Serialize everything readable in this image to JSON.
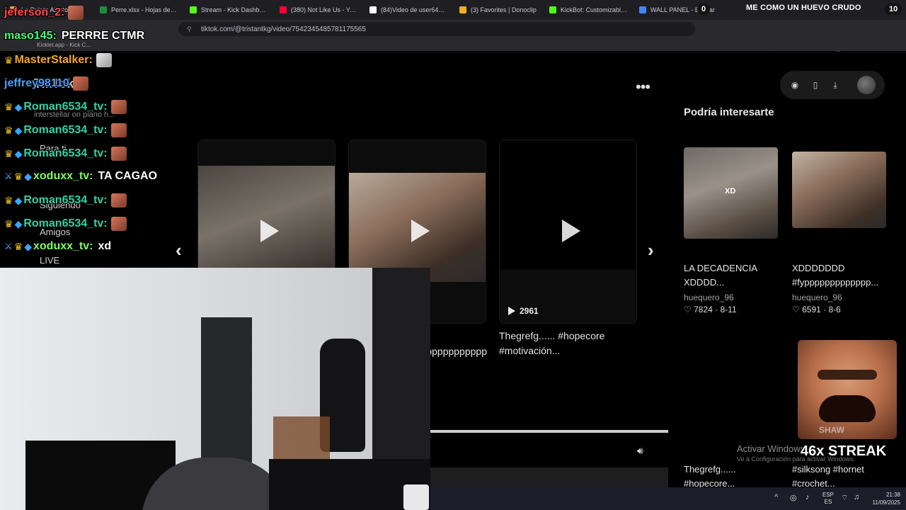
{
  "browser": {
    "tabs": [
      {
        "label": "La Ruleta Aleato...",
        "color": "#e5a93d"
      },
      {
        "label": "Perre.xlsx - Hojas de cálculo",
        "color": "#1e8e3e"
      },
      {
        "label": "Stream - Kick Dashboard",
        "color": "#53fc18"
      },
      {
        "label": "(380) Not Like Us - YouTube",
        "color": "#ff0033"
      },
      {
        "label": "(84)Video de user641381...",
        "color": "#ffffff"
      },
      {
        "label": "(3) Favorites | Donoclip",
        "color": "#f2b01e"
      },
      {
        "label": "KickBot: Customizable Cha...",
        "color": "#53fc18"
      },
      {
        "label": "WALL PANEL - Buscar",
        "color": "#4285f4"
      }
    ],
    "url": "tiktok.com/@tristantkg/video/7542345485781175565",
    "bookmarks_label": "Kicklet.app - Kick C..."
  },
  "overlay": {
    "counter_left": "0",
    "counter_right": "10",
    "top_message": "ME COMO UN HUEVO CRUDO"
  },
  "chat": [
    {
      "user": "jeferson_2:",
      "user_color": "#ff4d4d",
      "msg": "",
      "badges": [],
      "emote": "face"
    },
    {
      "user": "maso145:",
      "user_color": "#4cff7a",
      "msg": "PERRRE CTMR",
      "badges": [],
      "emote": ""
    },
    {
      "user": "MasterStalker:",
      "user_color": "#f5a623",
      "msg": "",
      "badges": [
        "crown"
      ],
      "emote": "cat"
    },
    {
      "user": "jeffrey98110",
      "user_color": "#4a9cff",
      "msg": "",
      "badges": [],
      "emote": "face"
    },
    {
      "user": "Roman6534_tv:",
      "user_color": "#33d1a6",
      "msg": "",
      "badges": [
        "crown",
        "gem"
      ],
      "emote": "face"
    },
    {
      "user": "Roman6534_tv:",
      "user_color": "#33d1a6",
      "msg": "",
      "badges": [
        "crown",
        "gem"
      ],
      "emote": "face"
    },
    {
      "user": "Roman6534_tv:",
      "user_color": "#33d1a6",
      "msg": "",
      "badges": [
        "crown",
        "gem"
      ],
      "emote": "face"
    },
    {
      "user": "xoduxx_tv:",
      "user_color": "#7cff5a",
      "msg": "TA CAGAO",
      "badges": [
        "sword",
        "crown",
        "gem"
      ],
      "emote": ""
    },
    {
      "user": "Roman6534_tv:",
      "user_color": "#33d1a6",
      "msg": "",
      "badges": [
        "crown",
        "gem"
      ],
      "emote": "face"
    },
    {
      "user": "Roman6534_tv:",
      "user_color": "#33d1a6",
      "msg": "",
      "badges": [
        "crown",
        "gem"
      ],
      "emote": "face"
    },
    {
      "user": "xoduxx_tv:",
      "user_color": "#7cff5a",
      "msg": "xd",
      "badges": [
        "sword",
        "crown",
        "gem"
      ],
      "emote": ""
    }
  ],
  "tiktok": {
    "logo": "TikTok",
    "search_placeholder": "interstellar on piano h...",
    "nav": {
      "for_you": "Para ti",
      "following": "Siguiendo",
      "friends": "Amigos",
      "live": "LIVE"
    },
    "section_title": "Podría interesarte",
    "cards": [
      {
        "title": "",
        "views": ""
      },
      {
        "title": "XDDDDDDD #fyppppppppppppp...",
        "views": ""
      },
      {
        "title": "Thegrefg...... #hopecore #motivación...",
        "views": "2961"
      }
    ],
    "recommended": [
      {
        "title": "LA DECADENCIA XDDDD...",
        "author": "huequero_96",
        "likes": "7824",
        "date": "8-11",
        "overlay": "XD"
      },
      {
        "title": "XDDDDDDD #fyppppppppppppp...",
        "author": "huequero_96",
        "likes": "6591",
        "date": "8-6",
        "overlay": ""
      },
      {
        "title": "Thegrefg...... #hopecore...",
        "author": "",
        "likes": "",
        "date": "",
        "overlay": ""
      },
      {
        "title": "#silksong #hornet #crochet...",
        "author": "",
        "likes": "",
        "date": "",
        "overlay": ""
      }
    ]
  },
  "streak": {
    "label": "46x STREAK",
    "watermark": "SHAW"
  },
  "windows": {
    "activate_title": "Activar Windows",
    "activate_sub": "Ve a Configuración para activar Windows.",
    "lang_top": "ESP",
    "lang_bottom": "ES",
    "time": "21:38",
    "date": "11/09/2025"
  }
}
